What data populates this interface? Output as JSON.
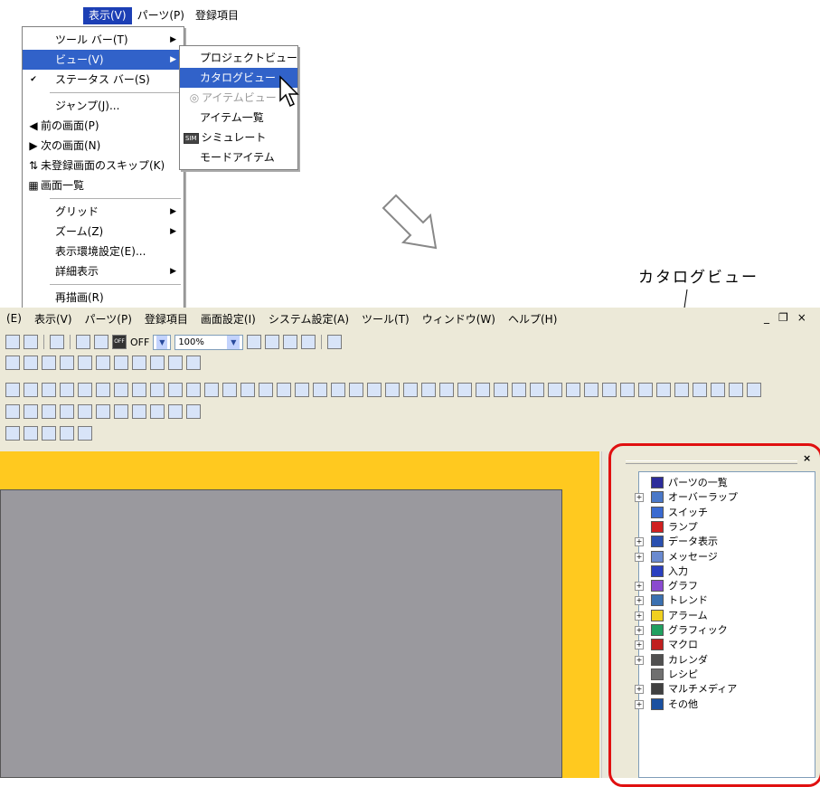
{
  "top_menubar": {
    "items": [
      "表示(V)",
      "パーツ(P)",
      "登録項目"
    ]
  },
  "view_menu": {
    "items": [
      {
        "label": "ツール バー(T)",
        "arrow": true
      },
      {
        "label": "ビュー(V)",
        "arrow": true
      },
      {
        "label": "ステータス バー(S)",
        "check": "✔"
      },
      {
        "label": "ジャンプ(J)..."
      },
      {
        "label": "前の画面(P)",
        "icon": "◀"
      },
      {
        "label": "次の画面(N)",
        "icon": "▶"
      },
      {
        "label": "未登録画面のスキップ(K)",
        "icon": "⇅"
      },
      {
        "label": "画面一覧",
        "icon": "▦"
      },
      {
        "label": "グリッド",
        "arrow": true
      },
      {
        "label": "ズーム(Z)",
        "arrow": true
      },
      {
        "label": "表示環境設定(E)..."
      },
      {
        "label": "詳細表示",
        "arrow": true
      },
      {
        "label": "再描画(R)"
      }
    ]
  },
  "view_submenu": {
    "items": [
      {
        "label": "プロジェクトビュー"
      },
      {
        "label": "カタログビュー"
      },
      {
        "label": "アイテムビュー",
        "icon": "◎"
      },
      {
        "label": "アイテム一覧"
      },
      {
        "label": "シミュレート",
        "icon": "SIM"
      },
      {
        "label": "モードアイテム"
      }
    ]
  },
  "annotation": "カタログビュー",
  "app_menubar": {
    "items": [
      "(E)",
      "表示(V)",
      "パーツ(P)",
      "登録項目",
      "画面設定(I)",
      "システム設定(A)",
      "ツール(T)",
      "ウィンドウ(W)",
      "ヘルプ(H)"
    ]
  },
  "window_controls": [
    "_",
    "❐",
    "×"
  ],
  "toolbar": {
    "off_label": "OFF",
    "zoom": "100%",
    "off_icon": "OFF"
  },
  "panel": {
    "close": "×"
  },
  "catalog_tree": [
    {
      "label": "パーツの一覧",
      "expand": "",
      "color": "#2c2c9a"
    },
    {
      "label": "オーバーラップ",
      "expand": "+",
      "color": "#4a78c8"
    },
    {
      "label": "スイッチ",
      "expand": "",
      "color": "#3a6ad0"
    },
    {
      "label": "ランプ",
      "expand": "",
      "color": "#d02020"
    },
    {
      "label": "データ表示",
      "expand": "+",
      "color": "#2a50b0"
    },
    {
      "label": "メッセージ",
      "expand": "+",
      "color": "#6a8ad0"
    },
    {
      "label": "入力",
      "expand": "",
      "color": "#2a40c0"
    },
    {
      "label": "グラフ",
      "expand": "+",
      "color": "#8a4ad0"
    },
    {
      "label": "トレンド",
      "expand": "+",
      "color": "#3a70b0"
    },
    {
      "label": "アラーム",
      "expand": "+",
      "color": "#f0d020"
    },
    {
      "label": "グラフィック",
      "expand": "+",
      "color": "#20a060"
    },
    {
      "label": "マクロ",
      "expand": "+",
      "color": "#c02020"
    },
    {
      "label": "カレンダ",
      "expand": "+",
      "color": "#505050"
    },
    {
      "label": "レシピ",
      "expand": "",
      "color": "#707070"
    },
    {
      "label": "マルチメディア",
      "expand": "+",
      "color": "#404040"
    },
    {
      "label": "その他",
      "expand": "+",
      "color": "#1a50a0"
    }
  ]
}
